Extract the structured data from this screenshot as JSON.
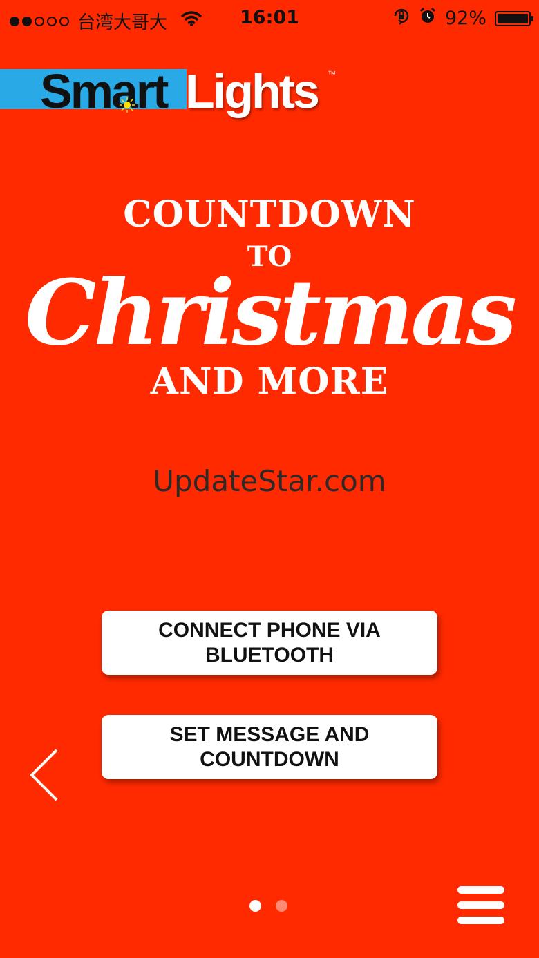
{
  "status_bar": {
    "signal_filled": 2,
    "signal_total": 5,
    "carrier": "台湾大哥大",
    "time": "16:01",
    "battery": "92%",
    "battery_level": 0.92
  },
  "logo": {
    "part1": "Smart",
    "part2": "Lights",
    "tm": "™"
  },
  "title": {
    "line1": "COUNTDOWN",
    "line2": "TO",
    "script": "Christmas",
    "line3": "AND MORE"
  },
  "watermark": "UpdateStar.com",
  "buttons": {
    "connect": "CONNECT PHONE VIA BLUETOOTH",
    "set_message": "SET MESSAGE AND COUNTDOWN"
  },
  "pager": {
    "current": 1,
    "total": 2
  },
  "colors": {
    "background": "#ff2a00",
    "logo_bar": "#29a9e6"
  },
  "icons": [
    "wifi-icon",
    "orientation-lock-icon",
    "alarm-icon",
    "battery-icon",
    "back-arrow-icon",
    "menu-icon"
  ]
}
